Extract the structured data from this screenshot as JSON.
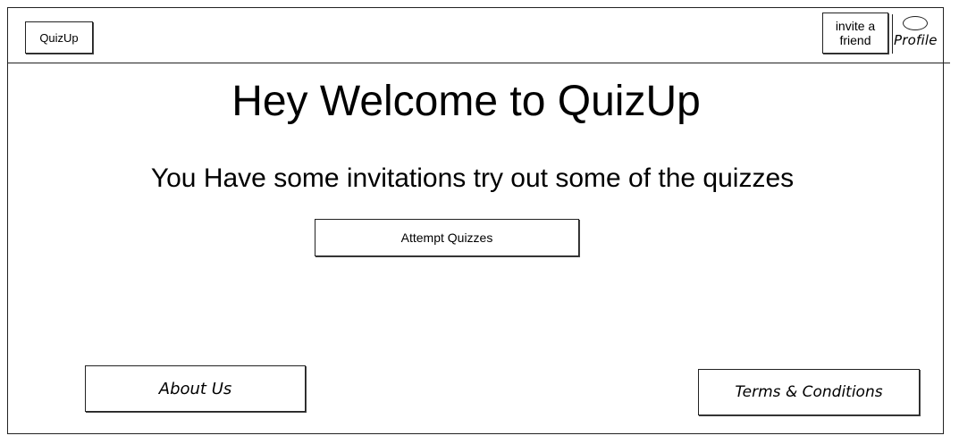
{
  "header": {
    "logo_label": "QuizUp",
    "invite_label": "invite a friend",
    "profile_label": "Profile"
  },
  "main": {
    "headline": "Hey Welcome to QuizUp",
    "subline": "You Have some invitations try out some of the quizzes",
    "attempt_label": "Attempt Quizzes"
  },
  "footer": {
    "about_label": "About Us",
    "terms_label": "Terms & Conditions"
  },
  "icons": {
    "profile": "profile-avatar-icon"
  }
}
